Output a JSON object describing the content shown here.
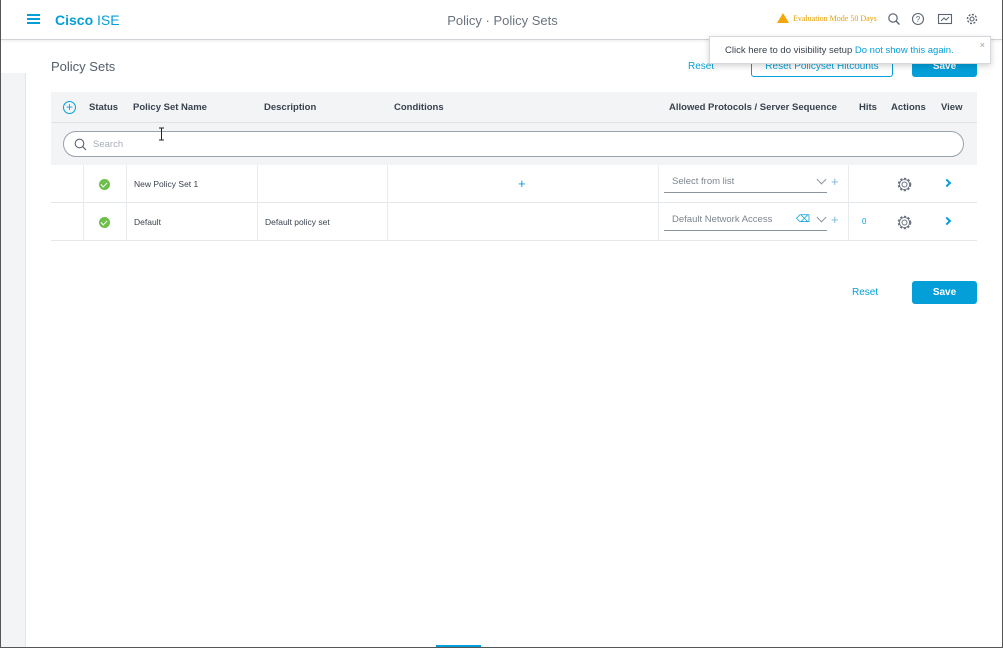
{
  "header": {
    "brand_bold": "Cisco",
    "brand_rest": " ISE",
    "title": "Policy · Policy Sets",
    "evaluation": "Evaluation Mode 50 Days"
  },
  "popup": {
    "text": "Click here to do visibility setup ",
    "link": "Do not show this again.",
    "close": "×"
  },
  "main": {
    "title": "Policy Sets",
    "reset_top": "Reset",
    "reset_hitcounts": "Reset Policyset Hitcounts",
    "save_top": "Save",
    "reset_bottom": "Reset",
    "save_bottom": "Save"
  },
  "table": {
    "columns": {
      "status": "Status",
      "name": "Policy Set Name",
      "description": "Description",
      "conditions": "Conditions",
      "protocols": "Allowed Protocols / Server Sequence",
      "hits": "Hits",
      "actions": "Actions",
      "view": "View"
    },
    "search_placeholder": "Search",
    "rows": [
      {
        "name": "New Policy Set 1",
        "description": "",
        "conditions_add": "+",
        "protocol": "Select from list",
        "hits": ""
      },
      {
        "name": "Default",
        "description": "Default policy set",
        "conditions_add": "",
        "protocol": "Default Network Access",
        "hits": "0"
      }
    ]
  },
  "colors": {
    "accent": "#049fd9",
    "status_ok": "#6cc04a",
    "warning": "#f4a60a"
  }
}
